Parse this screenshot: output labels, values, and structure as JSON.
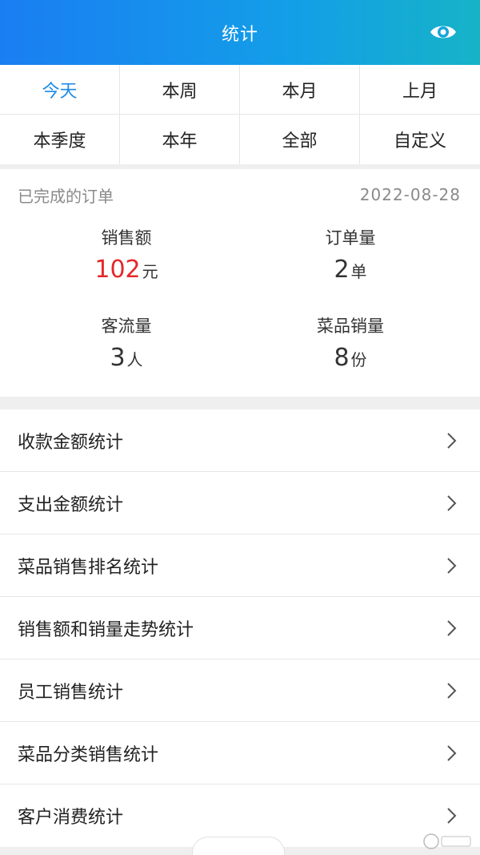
{
  "header": {
    "title": "统计",
    "eye_icon": "eye-icon"
  },
  "filters": [
    {
      "label": "今天",
      "active": true
    },
    {
      "label": "本周",
      "active": false
    },
    {
      "label": "本月",
      "active": false
    },
    {
      "label": "上月",
      "active": false
    },
    {
      "label": "本季度",
      "active": false
    },
    {
      "label": "本年",
      "active": false
    },
    {
      "label": "全部",
      "active": false
    },
    {
      "label": "自定义",
      "active": false
    }
  ],
  "summary": {
    "label": "已完成的订单",
    "date": "2022-08-28",
    "stats": [
      {
        "label": "销售额",
        "value": "102",
        "unit": "元",
        "highlight": true
      },
      {
        "label": "订单量",
        "value": "2",
        "unit": "单",
        "highlight": false
      },
      {
        "label": "客流量",
        "value": "3",
        "unit": "人",
        "highlight": false
      },
      {
        "label": "菜品销量",
        "value": "8",
        "unit": "份",
        "highlight": false
      }
    ]
  },
  "menu": [
    {
      "label": "收款金额统计"
    },
    {
      "label": "支出金额统计"
    },
    {
      "label": "菜品销售排名统计"
    },
    {
      "label": "销售额和销量走势统计"
    },
    {
      "label": "员工销售统计"
    },
    {
      "label": "菜品分类销售统计"
    },
    {
      "label": "客户消费统计"
    }
  ],
  "colors": {
    "accent": "#1c8be8",
    "highlight": "#e5272a",
    "header_start": "#1a7ef2",
    "header_end": "#16b3c7"
  }
}
